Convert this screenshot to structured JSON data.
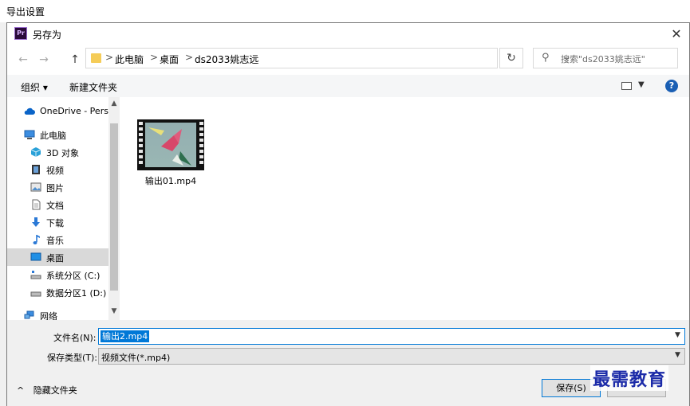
{
  "background_window": {
    "title": "导出设置"
  },
  "dialog": {
    "title": "另存为",
    "app_badge": "Pr"
  },
  "address_bar": {
    "breadcrumbs": [
      "此电脑",
      "桌面",
      "ds2033姚志远"
    ],
    "separator": ">"
  },
  "search": {
    "placeholder": "搜索\"ds2033姚志远\""
  },
  "toolbar": {
    "organize_label": "组织 ▾",
    "new_folder_label": "新建文件夹",
    "help_label": "?"
  },
  "nav_pane": {
    "items": [
      {
        "label": "OneDrive - Pers",
        "icon": "cloud-icon"
      },
      {
        "label": "此电脑",
        "icon": "computer-icon"
      },
      {
        "label": "3D 对象",
        "icon": "cube-icon"
      },
      {
        "label": "视频",
        "icon": "video-icon"
      },
      {
        "label": "图片",
        "icon": "picture-icon"
      },
      {
        "label": "文档",
        "icon": "document-icon"
      },
      {
        "label": "下载",
        "icon": "download-icon"
      },
      {
        "label": "音乐",
        "icon": "music-icon"
      },
      {
        "label": "桌面",
        "icon": "desktop-icon",
        "selected": true
      },
      {
        "label": "系统分区 (C:)",
        "icon": "drive-icon"
      },
      {
        "label": "数据分区1 (D:)",
        "icon": "drive-icon"
      },
      {
        "label": "网络",
        "icon": "network-icon"
      }
    ]
  },
  "files": [
    {
      "name": "输出01.mp4",
      "icon": "video-thumbnail"
    }
  ],
  "form": {
    "filename_label": "文件名(N):",
    "filename_value": "输出2.mp4",
    "filetype_label": "保存类型(T):",
    "filetype_value": "视频文件(*.mp4)",
    "hide_folders_label": "隐藏文件夹",
    "save_label": "保存(S)"
  },
  "watermark": "最需教育",
  "colors": {
    "accent": "#0078d7",
    "folder": "#f5cc58",
    "selection": "#d9d9d9",
    "watermark": "#1b2aa8"
  }
}
